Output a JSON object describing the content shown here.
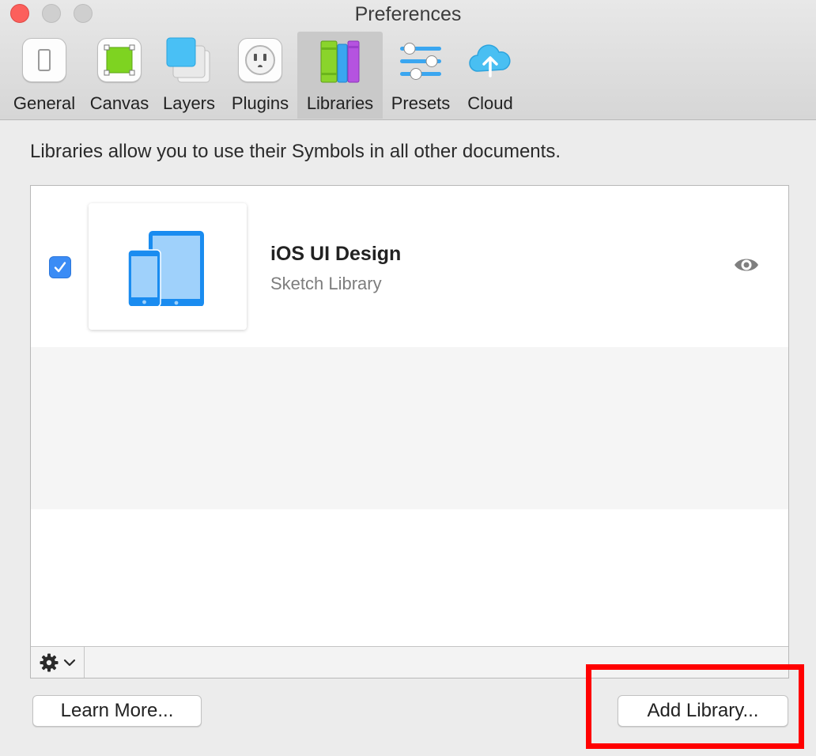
{
  "window": {
    "title": "Preferences"
  },
  "toolbar": {
    "items": [
      {
        "label": "General",
        "icon": "switch-icon"
      },
      {
        "label": "Canvas",
        "icon": "canvas-icon"
      },
      {
        "label": "Layers",
        "icon": "layers-icon"
      },
      {
        "label": "Plugins",
        "icon": "plug-socket-icon"
      },
      {
        "label": "Libraries",
        "icon": "books-icon",
        "selected": true
      },
      {
        "label": "Presets",
        "icon": "sliders-icon"
      },
      {
        "label": "Cloud",
        "icon": "cloud-upload-icon"
      }
    ]
  },
  "main": {
    "description": "Libraries allow you to use their Symbols in all other documents.",
    "libraries": [
      {
        "name": "iOS UI Design",
        "type": "Sketch Library",
        "enabled": true,
        "icon": "ios-devices-icon"
      }
    ]
  },
  "footer": {
    "learn_more_label": "Learn More...",
    "add_library_label": "Add Library..."
  },
  "colors": {
    "accent": "#3b8cf5",
    "highlight_box": "#ff0000",
    "device_blue": "#1a8cf0"
  }
}
